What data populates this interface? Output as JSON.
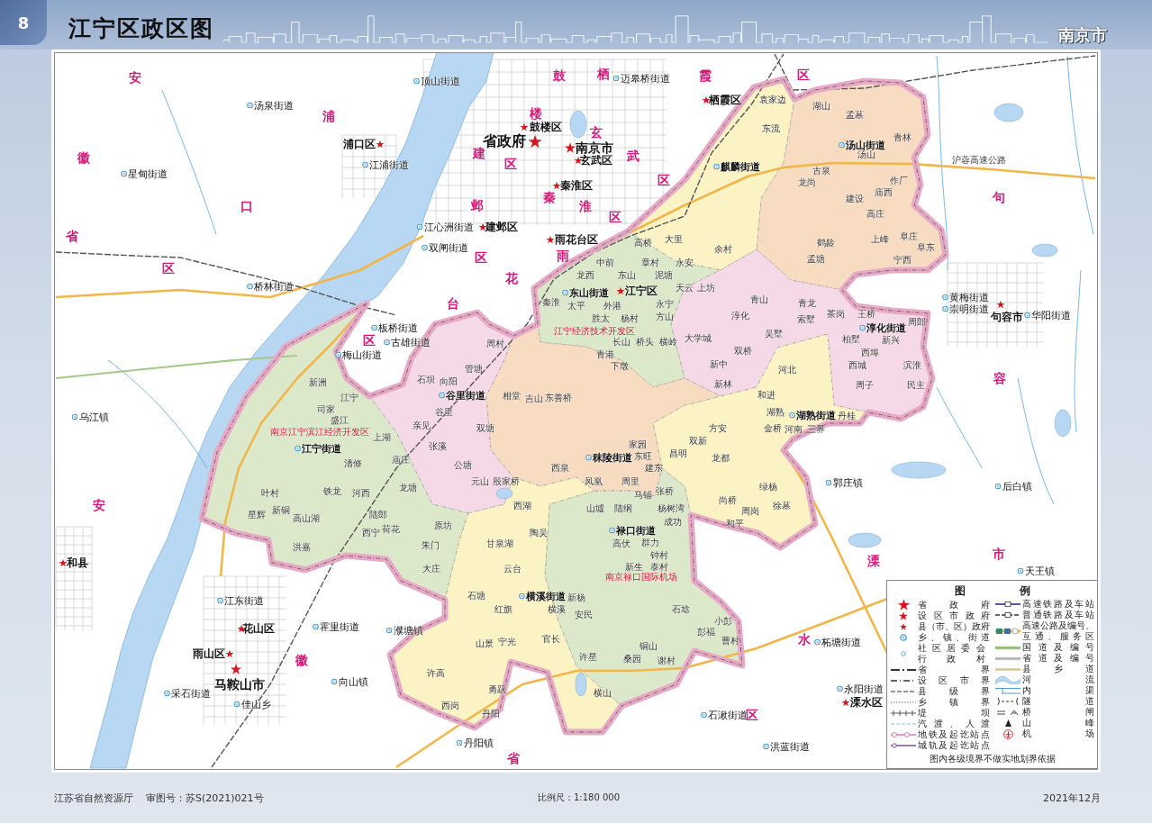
{
  "header": {
    "page_number": "8",
    "title": "江宁区政区图",
    "city": "南京市"
  },
  "map": {
    "subdistricts": [
      {
        "name": "汤山街道",
        "color": "#f7dcc2",
        "villages": [
          "湖山",
          "孟墓",
          "青林",
          "汤山",
          "古泉",
          "龙尚",
          "作厂",
          "建设",
          "庙西",
          "高庄",
          "鹤龄",
          "上峰",
          "阜庄",
          "阜东",
          "孟塘",
          "宁西"
        ]
      },
      {
        "name": "麒麟街道",
        "color": "#fbf3c3",
        "villages": [
          "袁家边",
          "东流",
          "余村"
        ]
      },
      {
        "name": "东山街道",
        "color": "#dbe8c9",
        "villages": [
          "高桥",
          "大里",
          "中前",
          "章村",
          "永安",
          "龙西",
          "东山",
          "泥塘",
          "天云",
          "上坊",
          "秦淮",
          "太平",
          "外港",
          "永宁",
          "胜太",
          "杨村",
          "方山",
          "长山",
          "桥头",
          "横岭"
        ]
      },
      {
        "name": "淳化街道",
        "color": "#f6d9e6",
        "villages": [
          "青山",
          "青龙",
          "淳化",
          "索墅",
          "茶岗",
          "王桥",
          "周郎",
          "大学城",
          "吴墅",
          "柏墅",
          "新兴",
          "双桥",
          "西埠",
          "新中",
          "西城",
          "滨淮",
          "新林",
          "周子",
          "民主"
        ]
      },
      {
        "name": "谷里街道",
        "color": "#f6d9e6",
        "villages": [
          "周村",
          "管塘",
          "石坝",
          "向阳",
          "谷里",
          "亲见",
          "张溪",
          "公塘",
          "元山"
        ]
      },
      {
        "name": "湖熟街道",
        "color": "#fbf3c3",
        "villages": [
          "河北",
          "和进",
          "湖熟",
          "丹桂",
          "方安",
          "金桥",
          "河南",
          "三界",
          "双新",
          "昌明",
          "龙都",
          "绿杨",
          "尚桥",
          "周岗",
          "徐墓",
          "和平"
        ]
      },
      {
        "name": "江宁街道",
        "color": "#dbe8c9",
        "villages": [
          "新洲",
          "江宁",
          "司家",
          "盛江",
          "上湖",
          "清修",
          "庙庄",
          "叶村",
          "铁龙",
          "河西",
          "龙塘",
          "星辉",
          "新铜",
          "高山湖",
          "陆郎",
          "西宁",
          "荷花",
          "原坊",
          "洪嘉",
          "朱门",
          "大庄"
        ]
      },
      {
        "name": "秣陵街道",
        "color": "#f7dcc2",
        "villages": [
          "青港",
          "下墩",
          "相堂",
          "吉山",
          "东善桥",
          "双塘",
          "家园",
          "东旺",
          "西泉",
          "建东",
          "殷家桥",
          "凤凰",
          "周里"
        ]
      },
      {
        "name": "禄口街道",
        "color": "#dbe8c9",
        "villages": [
          "马铺",
          "张桥",
          "山墟",
          "陆纲",
          "杨树湾",
          "成功",
          "陶吴",
          "高伏",
          "群力",
          "钟村",
          "新生",
          "泰村",
          "石埝",
          "小彭",
          "彭福",
          "铜山",
          "曹村",
          "桑园",
          "谢村"
        ]
      },
      {
        "name": "横溪街道",
        "color": "#fbf3c3",
        "villages": [
          "西湖",
          "甘泉湖",
          "云台",
          "石塘",
          "新杨",
          "红旗",
          "横溪",
          "安民",
          "山景",
          "宁光",
          "官长",
          "许星",
          "许高",
          "勇跃",
          "横山",
          "西岗",
          "丹阳"
        ]
      }
    ],
    "area_names": [
      {
        "letters": [
          "安",
          "徽",
          "省"
        ]
      },
      {
        "letters": [
          "鼓",
          "楼",
          "区"
        ]
      },
      {
        "letters": [
          "栖",
          "霞",
          "区"
        ]
      },
      {
        "letters": [
          "浦",
          "口",
          "区"
        ]
      },
      {
        "letters": [
          "玄",
          "武",
          "区"
        ]
      },
      {
        "letters": [
          "建",
          "邺",
          "区"
        ]
      },
      {
        "letters": [
          "秦",
          "淮",
          "区"
        ]
      },
      {
        "letters": [
          "句",
          "容",
          "市"
        ]
      },
      {
        "letters": [
          "雨",
          "花",
          "台",
          "区"
        ]
      },
      {
        "letters": [
          "安",
          "徽",
          "省"
        ]
      },
      {
        "letters": [
          "溧",
          "水",
          "区"
        ]
      }
    ],
    "seats": [
      {
        "name": "栖霞区",
        "kind": "county"
      },
      {
        "name": "鼓楼区",
        "kind": "county"
      },
      {
        "name": "浦口区",
        "kind": "county"
      },
      {
        "name": "省政府",
        "kind": "province"
      },
      {
        "name": "南京市",
        "kind": "city"
      },
      {
        "name": "玄武区",
        "kind": "county"
      },
      {
        "name": "秦淮区",
        "kind": "county"
      },
      {
        "name": "建邺区",
        "kind": "county"
      },
      {
        "name": "雨花台区",
        "kind": "county"
      },
      {
        "name": "江宁区",
        "kind": "county"
      },
      {
        "name": "句容市",
        "kind": "county"
      },
      {
        "name": "和县",
        "kind": "county"
      },
      {
        "name": "花山区",
        "kind": "county"
      },
      {
        "name": "雨山区",
        "kind": "county"
      },
      {
        "name": "马鞍山市",
        "kind": "city"
      },
      {
        "name": "溧水区",
        "kind": "county"
      }
    ],
    "towns": [
      "顶山街道",
      "迈皋桥街道",
      "汤泉街道",
      "星甸街道",
      "江浦街道",
      "江心洲街道",
      "双闸街道",
      "桥林街道",
      "黄梅街道",
      "崇明街道",
      "华阳街道",
      "板桥街道",
      "古雄街道",
      "梅山街道",
      "乌江镇",
      "郭庄镇",
      "后白镇",
      "天王镇",
      "江东街道",
      "霍里街道",
      "濮塘镇",
      "柘塘街道",
      "向山镇",
      "采石街道",
      "永阳街道",
      "佳山乡",
      "石湫街道",
      "丹阳镇",
      "洪蓝街道"
    ],
    "road_labels": [
      "沪蓉高速公路"
    ],
    "zones": [
      "江宁经济技术开发区",
      "南京江宁滨江经济开发区",
      "南京禄口国际机场"
    ]
  },
  "legend": {
    "title": "图 例",
    "left": [
      {
        "kind": "star_province",
        "label": "省政府"
      },
      {
        "kind": "star_city",
        "label": "设区市政府"
      },
      {
        "kind": "star_county",
        "label": "县（市、区）政府"
      },
      {
        "kind": "town_dot",
        "label": "乡、镇、街道"
      },
      {
        "kind": "village_dot",
        "label": "社区居委会行政村"
      },
      {
        "kind": "province_border",
        "label": "省界"
      },
      {
        "kind": "city_border",
        "label": "设区市界"
      },
      {
        "kind": "county_border",
        "label": "县级界"
      },
      {
        "kind": "township_border",
        "label": "乡镇界"
      },
      {
        "kind": "dike",
        "label": "堤坝"
      },
      {
        "kind": "ferry",
        "label": "汽渡、人渡"
      },
      {
        "kind": "metro",
        "label": "地铁及起讫站点"
      },
      {
        "kind": "intercity_rail",
        "label": "城轨及起讫站点"
      }
    ],
    "right": [
      {
        "kind": "high_speed_rail",
        "label": "高速铁路及车站"
      },
      {
        "kind": "railway",
        "label": "普通铁路及车站"
      },
      {
        "kind": "expressway",
        "label": "高速公路及编号、互通、服务区"
      },
      {
        "kind": "national_road",
        "label": "国道及编号"
      },
      {
        "kind": "provincial_road",
        "label": "省道及编号"
      },
      {
        "kind": "county_road",
        "label": "县乡道"
      },
      {
        "kind": "river",
        "label": "河流"
      },
      {
        "kind": "canal",
        "label": "内渠"
      },
      {
        "kind": "tunnel",
        "label": "隧道"
      },
      {
        "kind": "bridge_sluice",
        "label": "桥闸"
      },
      {
        "kind": "peak",
        "label": "山峰"
      },
      {
        "kind": "airport",
        "label": "机场"
      }
    ],
    "note": "图内各级境界不做实地划界依据"
  },
  "footer": {
    "publisher": "江苏省自然资源厅",
    "approval": "审图号：苏S(2021)021号",
    "scale": "比例尺：1:180 000",
    "date": "2021年12月"
  }
}
